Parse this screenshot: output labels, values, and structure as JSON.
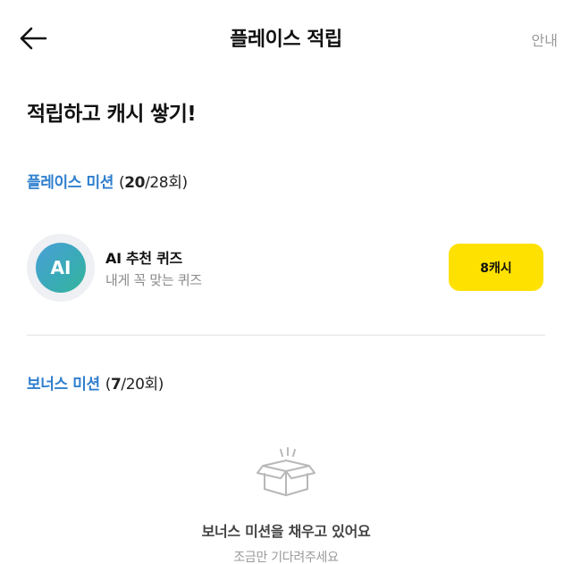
{
  "header": {
    "title": "플레이스 적립",
    "guide_label": "안내",
    "back_icon": "arrow-left-icon"
  },
  "headline": "적립하고 캐시 쌓기!",
  "place_missions": {
    "label": "플레이스 미션",
    "count_open": "(",
    "count_done": "20",
    "count_rest": "/28회)",
    "items": [
      {
        "avatar_text": "AI",
        "name": "AI 추천 퀴즈",
        "description": "내게 꼭 맞는 퀴즈",
        "reward_label": "8캐시"
      }
    ]
  },
  "bonus_missions": {
    "label": "보너스 미션",
    "count_open": "(",
    "count_done": "7",
    "count_rest": "/20회)",
    "empty_icon": "open-box-icon",
    "empty_title": "보너스 미션을 채우고 있어요",
    "empty_subtitle": "조금만 기다려주세요"
  },
  "colors": {
    "accent_blue": "#2f7fcf",
    "reward_yellow": "#ffe100",
    "muted_text": "#8a8a8a"
  }
}
